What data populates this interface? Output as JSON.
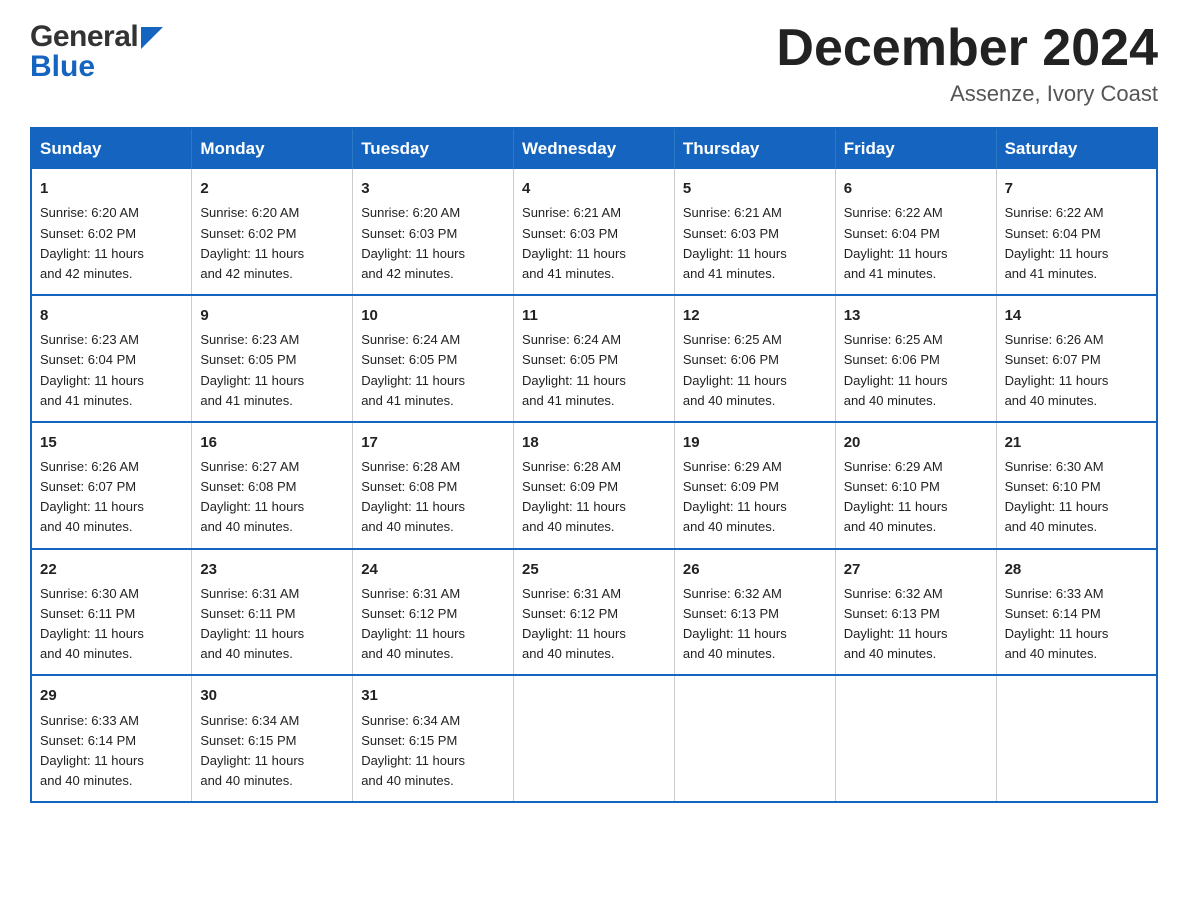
{
  "header": {
    "logo_general": "General",
    "logo_blue": "Blue",
    "month_title": "December 2024",
    "location": "Assenze, Ivory Coast"
  },
  "days_of_week": [
    "Sunday",
    "Monday",
    "Tuesday",
    "Wednesday",
    "Thursday",
    "Friday",
    "Saturday"
  ],
  "weeks": [
    [
      {
        "day": "1",
        "sunrise": "6:20 AM",
        "sunset": "6:02 PM",
        "daylight": "11 hours and 42 minutes."
      },
      {
        "day": "2",
        "sunrise": "6:20 AM",
        "sunset": "6:02 PM",
        "daylight": "11 hours and 42 minutes."
      },
      {
        "day": "3",
        "sunrise": "6:20 AM",
        "sunset": "6:03 PM",
        "daylight": "11 hours and 42 minutes."
      },
      {
        "day": "4",
        "sunrise": "6:21 AM",
        "sunset": "6:03 PM",
        "daylight": "11 hours and 41 minutes."
      },
      {
        "day": "5",
        "sunrise": "6:21 AM",
        "sunset": "6:03 PM",
        "daylight": "11 hours and 41 minutes."
      },
      {
        "day": "6",
        "sunrise": "6:22 AM",
        "sunset": "6:04 PM",
        "daylight": "11 hours and 41 minutes."
      },
      {
        "day": "7",
        "sunrise": "6:22 AM",
        "sunset": "6:04 PM",
        "daylight": "11 hours and 41 minutes."
      }
    ],
    [
      {
        "day": "8",
        "sunrise": "6:23 AM",
        "sunset": "6:04 PM",
        "daylight": "11 hours and 41 minutes."
      },
      {
        "day": "9",
        "sunrise": "6:23 AM",
        "sunset": "6:05 PM",
        "daylight": "11 hours and 41 minutes."
      },
      {
        "day": "10",
        "sunrise": "6:24 AM",
        "sunset": "6:05 PM",
        "daylight": "11 hours and 41 minutes."
      },
      {
        "day": "11",
        "sunrise": "6:24 AM",
        "sunset": "6:05 PM",
        "daylight": "11 hours and 41 minutes."
      },
      {
        "day": "12",
        "sunrise": "6:25 AM",
        "sunset": "6:06 PM",
        "daylight": "11 hours and 40 minutes."
      },
      {
        "day": "13",
        "sunrise": "6:25 AM",
        "sunset": "6:06 PM",
        "daylight": "11 hours and 40 minutes."
      },
      {
        "day": "14",
        "sunrise": "6:26 AM",
        "sunset": "6:07 PM",
        "daylight": "11 hours and 40 minutes."
      }
    ],
    [
      {
        "day": "15",
        "sunrise": "6:26 AM",
        "sunset": "6:07 PM",
        "daylight": "11 hours and 40 minutes."
      },
      {
        "day": "16",
        "sunrise": "6:27 AM",
        "sunset": "6:08 PM",
        "daylight": "11 hours and 40 minutes."
      },
      {
        "day": "17",
        "sunrise": "6:28 AM",
        "sunset": "6:08 PM",
        "daylight": "11 hours and 40 minutes."
      },
      {
        "day": "18",
        "sunrise": "6:28 AM",
        "sunset": "6:09 PM",
        "daylight": "11 hours and 40 minutes."
      },
      {
        "day": "19",
        "sunrise": "6:29 AM",
        "sunset": "6:09 PM",
        "daylight": "11 hours and 40 minutes."
      },
      {
        "day": "20",
        "sunrise": "6:29 AM",
        "sunset": "6:10 PM",
        "daylight": "11 hours and 40 minutes."
      },
      {
        "day": "21",
        "sunrise": "6:30 AM",
        "sunset": "6:10 PM",
        "daylight": "11 hours and 40 minutes."
      }
    ],
    [
      {
        "day": "22",
        "sunrise": "6:30 AM",
        "sunset": "6:11 PM",
        "daylight": "11 hours and 40 minutes."
      },
      {
        "day": "23",
        "sunrise": "6:31 AM",
        "sunset": "6:11 PM",
        "daylight": "11 hours and 40 minutes."
      },
      {
        "day": "24",
        "sunrise": "6:31 AM",
        "sunset": "6:12 PM",
        "daylight": "11 hours and 40 minutes."
      },
      {
        "day": "25",
        "sunrise": "6:31 AM",
        "sunset": "6:12 PM",
        "daylight": "11 hours and 40 minutes."
      },
      {
        "day": "26",
        "sunrise": "6:32 AM",
        "sunset": "6:13 PM",
        "daylight": "11 hours and 40 minutes."
      },
      {
        "day": "27",
        "sunrise": "6:32 AM",
        "sunset": "6:13 PM",
        "daylight": "11 hours and 40 minutes."
      },
      {
        "day": "28",
        "sunrise": "6:33 AM",
        "sunset": "6:14 PM",
        "daylight": "11 hours and 40 minutes."
      }
    ],
    [
      {
        "day": "29",
        "sunrise": "6:33 AM",
        "sunset": "6:14 PM",
        "daylight": "11 hours and 40 minutes."
      },
      {
        "day": "30",
        "sunrise": "6:34 AM",
        "sunset": "6:15 PM",
        "daylight": "11 hours and 40 minutes."
      },
      {
        "day": "31",
        "sunrise": "6:34 AM",
        "sunset": "6:15 PM",
        "daylight": "11 hours and 40 minutes."
      },
      null,
      null,
      null,
      null
    ]
  ],
  "labels": {
    "sunrise": "Sunrise:",
    "sunset": "Sunset:",
    "daylight": "Daylight:"
  }
}
